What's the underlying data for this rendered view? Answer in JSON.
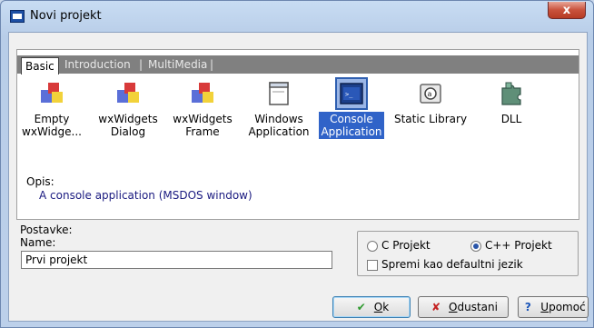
{
  "window": {
    "title": "Novi projekt",
    "close_label": "x"
  },
  "tabs": [
    {
      "label": "Basic"
    },
    {
      "label": "Introduction"
    },
    {
      "label": "MultiMedia"
    }
  ],
  "tab_separator": "|",
  "items": [
    {
      "line1": "Empty",
      "line2": "wxWidge...",
      "icon": "wx-blocks-icon"
    },
    {
      "line1": "wxWidgets",
      "line2": "Dialog",
      "icon": "wx-blocks-icon"
    },
    {
      "line1": "wxWidgets",
      "line2": "Frame",
      "icon": "wx-blocks-icon"
    },
    {
      "line1": "Windows",
      "line2": "Application",
      "icon": "window-icon"
    },
    {
      "line1": "Console",
      "line2": "Application",
      "icon": "console-icon"
    },
    {
      "line1": "Static Library",
      "line2": "",
      "icon": "static-library-icon"
    },
    {
      "line1": "DLL",
      "line2": "",
      "icon": "dll-puzzle-icon"
    }
  ],
  "description": {
    "label": "Opis:",
    "text": "A console application (MSDOS window)"
  },
  "settings": {
    "group_label": "Postavke:",
    "name_label": "Name:",
    "name_value": "Prvi projekt",
    "c_option": "C Projekt",
    "cpp_option": "C++ Projekt",
    "default_checkbox": "Spremi kao defaultni jezik"
  },
  "buttons": {
    "ok": {
      "key": "O",
      "rest": "k"
    },
    "cancel": {
      "key": "O",
      "rest": "dustani"
    },
    "help": {
      "key": "U",
      "rest": "pomoć"
    }
  },
  "colors": {
    "selection": "#3063c8",
    "description_text": "#1a1a80",
    "close_button": "#c9523c"
  }
}
